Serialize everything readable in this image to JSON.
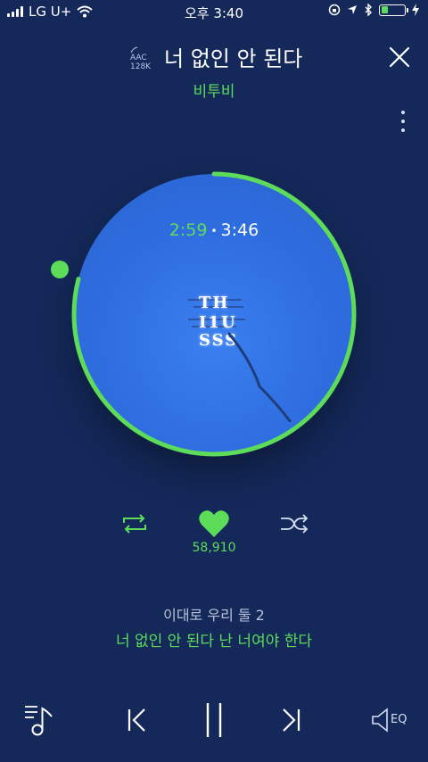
{
  "status_bar": {
    "carrier": "LG U+",
    "time": "오후 3:40",
    "battery_level": 0.3
  },
  "header": {
    "quality_codec": "AAC",
    "quality_bitrate": "128K",
    "song_title": "너 없인 안 된다",
    "artist": "비투비"
  },
  "player": {
    "elapsed": "2:59",
    "total": "3:46",
    "progress": 0.79,
    "likes": "58,910",
    "liked": true
  },
  "lyrics": {
    "previous_line": "이대로 우리 둘 2",
    "current_line": "너 없인 안 된다 난 너여야 한다"
  },
  "album_art": {
    "lines": [
      "TH",
      "I1U",
      "SSS"
    ]
  },
  "controls": {
    "eq_label": "EQ"
  },
  "colors": {
    "accent": "#5ddc5a",
    "background": "#14295a",
    "disc": "#2f6ee0"
  }
}
